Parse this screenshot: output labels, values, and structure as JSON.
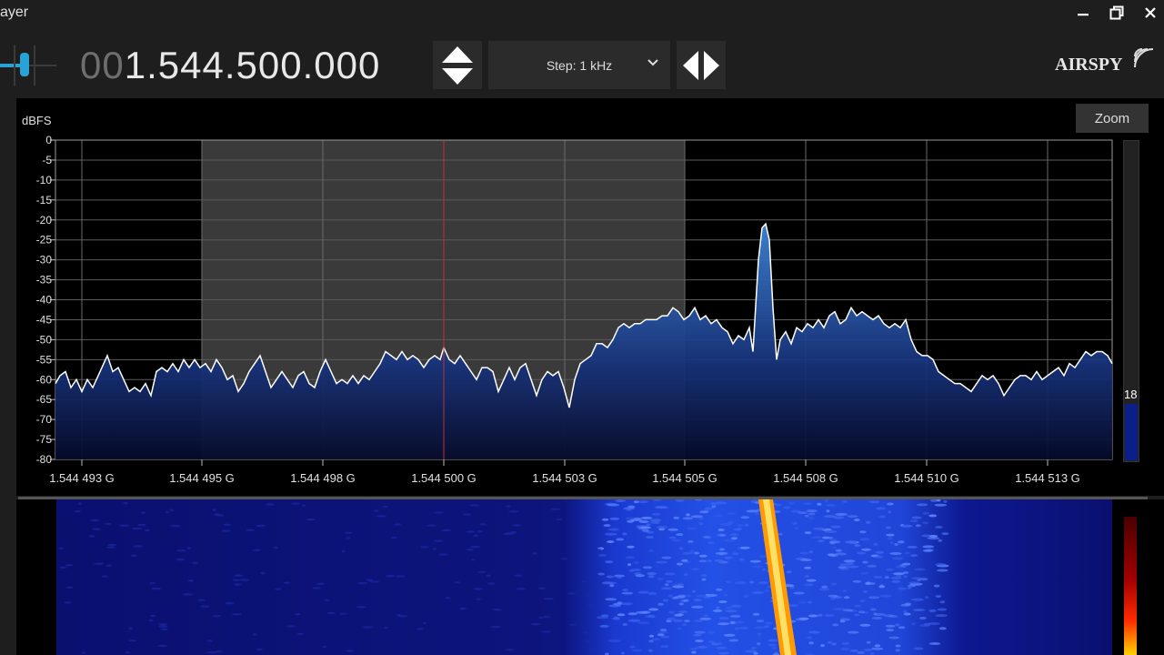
{
  "window": {
    "title": "ayer"
  },
  "toolbar": {
    "frequency_lead": "00",
    "frequency_main": "1.544.500.000",
    "step_label": "Step: 1 kHz",
    "logo": "AIRSPY"
  },
  "spectrum": {
    "zoom_label": "Zoom",
    "level_value": "18",
    "yunit": "dBFS",
    "yticks": [
      "0",
      "-5",
      "-10",
      "-15",
      "-20",
      "-25",
      "-30",
      "-35",
      "-40",
      "-45",
      "-50",
      "-55",
      "-60",
      "-65",
      "-70",
      "-75",
      "-80"
    ],
    "xticks": [
      "1.544 493 G",
      "1.544 495 G",
      "1.544 498 G",
      "1.544 500 G",
      "1.544 503 G",
      "1.544 505 G",
      "1.544 508 G",
      "1.544 510 G",
      "1.544 513 G"
    ]
  },
  "colors": {
    "background": "#1e1e1e",
    "plot_bg": "#000000",
    "passband": "#3b3b3b",
    "spectrum_fill": "#2a5db5",
    "center_line": "#c03030",
    "waterfall_signal": "#ffc000"
  },
  "icons": [
    "up-down-arrows-icon",
    "chevron-down-icon",
    "left-right-arrows-icon",
    "minimize-icon",
    "restore-icon",
    "close-icon",
    "airspy-wifi-icon",
    "volume-slider-icon"
  ]
}
